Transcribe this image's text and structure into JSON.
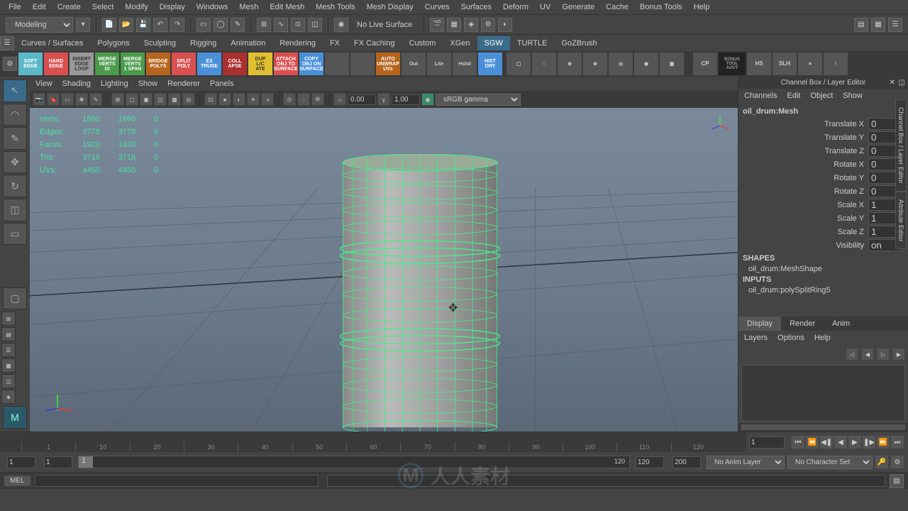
{
  "menubar": [
    "File",
    "Edit",
    "Create",
    "Select",
    "Modify",
    "Display",
    "Windows",
    "Mesh",
    "Edit Mesh",
    "Mesh Tools",
    "Mesh Display",
    "Curves",
    "Surfaces",
    "Deform",
    "UV",
    "Generate",
    "Cache",
    "Bonus Tools",
    "Help"
  ],
  "mode": "Modeling",
  "live_surface": "No Live Surface",
  "shelf_tabs": [
    "Curves / Surfaces",
    "Polygons",
    "Sculpting",
    "Rigging",
    "Animation",
    "Rendering",
    "FX",
    "FX Caching",
    "Custom",
    "XGen",
    "SGW",
    "TURTLE",
    "GoZBrush"
  ],
  "shelf_active": "SGW",
  "shelf_icons": [
    {
      "label": "SOFT\nEDGE",
      "cls": "si-soft"
    },
    {
      "label": "HARD\nEDGE",
      "cls": "si-hard"
    },
    {
      "label": "INSERT\nEDGE\nLOOP",
      "cls": "si-insert"
    },
    {
      "label": "MERGE\nVERTS\n10",
      "cls": "si-merge"
    },
    {
      "label": "MERGE\nVERTS\n1 SPAN",
      "cls": "si-merge"
    },
    {
      "label": "BRIDGE\nPOLYS",
      "cls": "si-border"
    },
    {
      "label": "SPLIT\nPOLY",
      "cls": "si-split"
    },
    {
      "label": "EX\nTRUDE",
      "cls": "si-extrude"
    },
    {
      "label": "COLL\nAPSE",
      "cls": "si-collapse"
    },
    {
      "label": "DUP\nLIC\nATE",
      "cls": "si-dup"
    },
    {
      "label": "ATTACH\nOBJ TO\nSURFACE",
      "cls": "si-attach"
    },
    {
      "label": "COPY\nOBJ ON\nSURFACE",
      "cls": "si-copy"
    },
    {
      "label": "",
      "cls": "si-generic"
    },
    {
      "label": "",
      "cls": "si-generic"
    },
    {
      "label": "AUTO\nUNWRAP\nUVs",
      "cls": "si-border"
    },
    {
      "label": "Out",
      "cls": "si-generic"
    },
    {
      "label": "Lite",
      "cls": "si-generic"
    },
    {
      "label": "Hshd",
      "cls": "si-generic"
    },
    {
      "label": "HIST\nORY",
      "cls": "si-extrude"
    }
  ],
  "view_menu": [
    "View",
    "Shading",
    "Lighting",
    "Show",
    "Renderer",
    "Panels"
  ],
  "view_rot": "0.00",
  "view_scale": "1.00",
  "color_space": "sRGB gamma",
  "stats": {
    "rows": [
      {
        "label": "Verts:",
        "a": "1860",
        "b": "1860",
        "c": "0"
      },
      {
        "label": "Edges:",
        "a": "3778",
        "b": "3778",
        "c": "0"
      },
      {
        "label": "Faces:",
        "a": "1920",
        "b": "1920",
        "c": "0"
      },
      {
        "label": "Tris:",
        "a": "3716",
        "b": "3716",
        "c": "0"
      },
      {
        "label": "UVs:",
        "a": "4450",
        "b": "4450",
        "c": "0"
      }
    ]
  },
  "channel": {
    "title": "Channel Box / Layer Editor",
    "menu": [
      "Channels",
      "Edit",
      "Object",
      "Show"
    ],
    "object": "oil_drum:Mesh",
    "attrs": [
      {
        "label": "Translate X",
        "val": "0"
      },
      {
        "label": "Translate Y",
        "val": "0"
      },
      {
        "label": "Translate Z",
        "val": "0"
      },
      {
        "label": "Rotate X",
        "val": "0"
      },
      {
        "label": "Rotate Y",
        "val": "0"
      },
      {
        "label": "Rotate Z",
        "val": "0"
      },
      {
        "label": "Scale X",
        "val": "1"
      },
      {
        "label": "Scale Y",
        "val": "1"
      },
      {
        "label": "Scale Z",
        "val": "1"
      },
      {
        "label": "Visibility",
        "val": "on"
      }
    ],
    "shapes_hdr": "SHAPES",
    "shape_item": "oil_drum:MeshShape",
    "inputs_hdr": "INPUTS",
    "input_item": "oil_drum:polySplitRing5",
    "layer_tabs": [
      "Display",
      "Render",
      "Anim"
    ],
    "layer_menu": [
      "Layers",
      "Options",
      "Help"
    ]
  },
  "vert_tabs": [
    "Channel Box / Layer Editor",
    "Attribute Editor"
  ],
  "timeline": {
    "ticks": [
      "1",
      "10",
      "20",
      "30",
      "40",
      "50",
      "60",
      "70",
      "80",
      "90",
      "100",
      "110",
      "120"
    ],
    "start_range": "1",
    "start": "1",
    "current": "1",
    "end": "120",
    "end_range": "120",
    "total": "200",
    "anim_layer": "No Anim Layer",
    "char_set": "No Character Set"
  },
  "cmdline_lang": "MEL",
  "watermark": "人人素材"
}
